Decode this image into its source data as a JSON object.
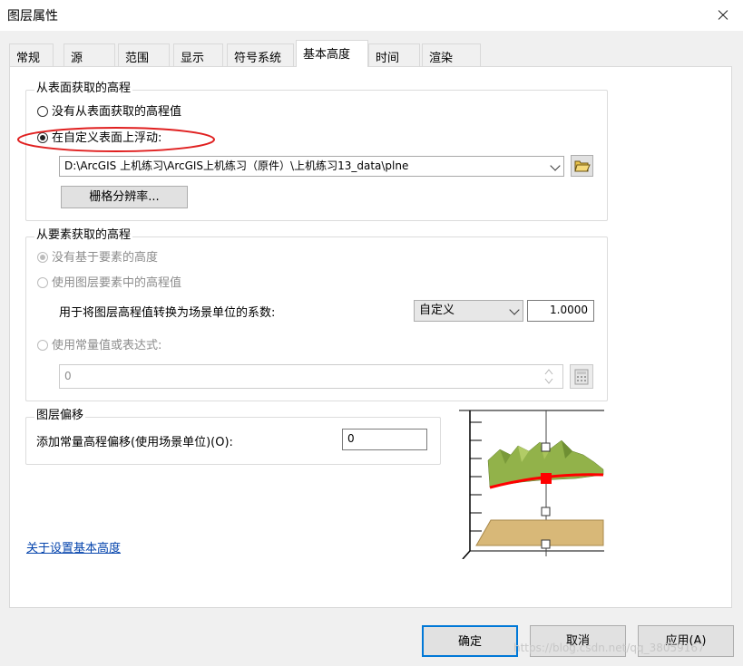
{
  "window": {
    "title": "图层属性"
  },
  "tabs": [
    "常规",
    "源",
    "范围",
    "显示",
    "符号系统",
    "基本高度",
    "时间",
    "渲染"
  ],
  "active_tab": "基本高度",
  "surface_group": {
    "legend": "从表面获取的高程",
    "option_none": "没有从表面获取的高程值",
    "option_float": "在自定义表面上浮动:",
    "selected": "option_float",
    "surface_path": "D:\\ArcGIS 上机练习\\ArcGIS上机练习（原件）\\上机练习13_data\\plne",
    "raster_button": "栅格分辨率..."
  },
  "feature_group": {
    "legend": "从要素获取的高程",
    "option_none": "没有基于要素的高度",
    "option_layer": "使用图层要素中的高程值",
    "factor_label": "用于将图层高程值转换为场景单位的系数:",
    "factor_unit": "自定义",
    "factor_value": "1.0000",
    "option_expression": "使用常量值或表达式:",
    "expression_value": "0"
  },
  "offset_group": {
    "legend": "图层偏移",
    "label": "添加常量高程偏移(使用场景单位)(O):",
    "value": "0"
  },
  "help_link": "关于设置基本高度",
  "buttons": {
    "ok": "确定",
    "cancel": "取消",
    "apply": "应用(A)"
  },
  "watermark": "https://blog.csdn.net/qq_38059167",
  "highlight_color": "#e02020"
}
